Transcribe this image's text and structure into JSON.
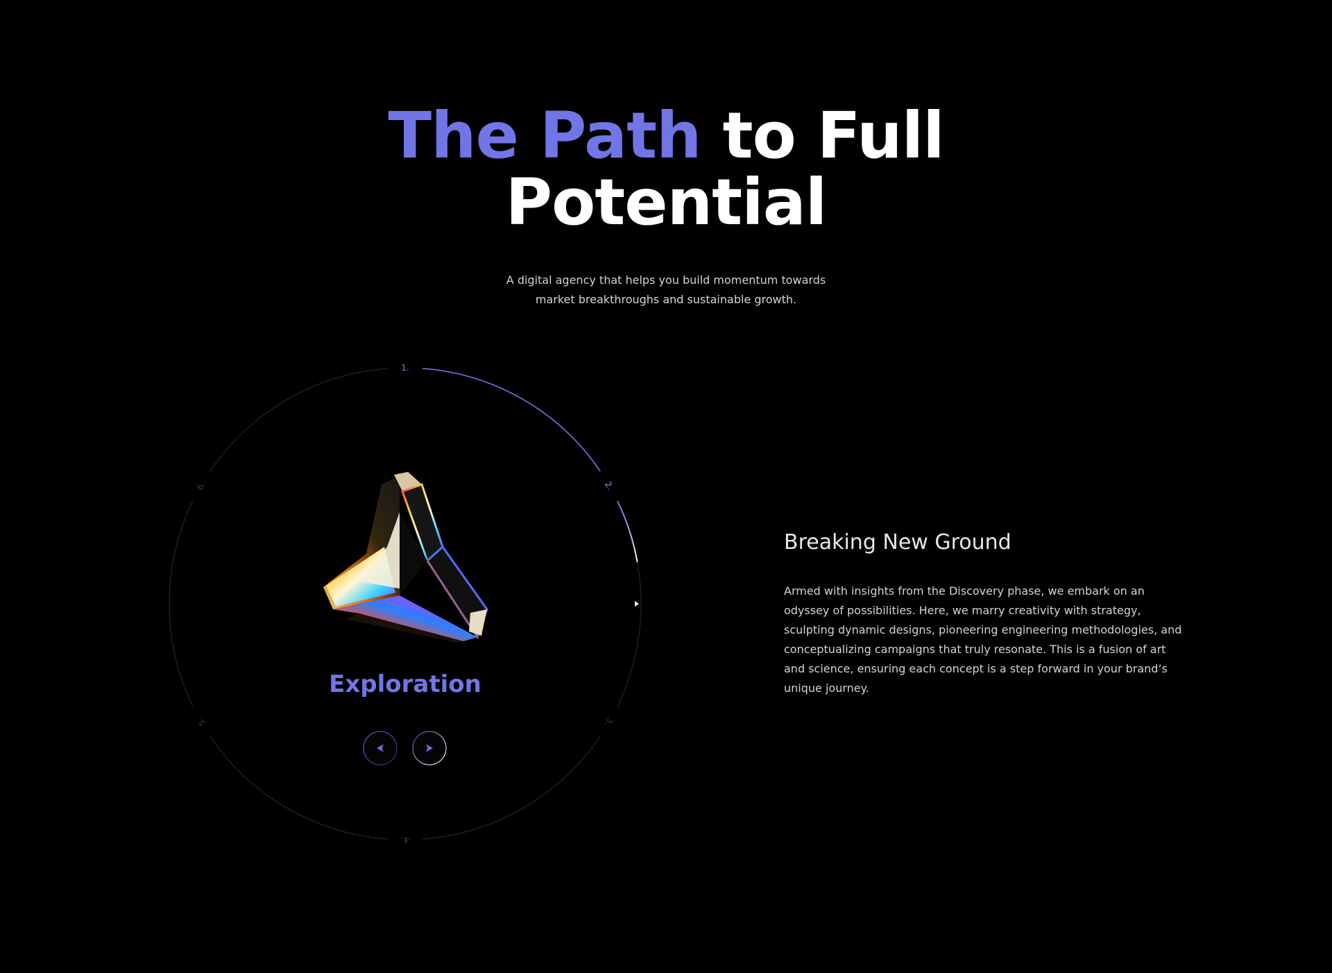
{
  "hero": {
    "title_accent": "The Path",
    "title_rest": " to Full",
    "title_line2": "Potential",
    "subtitle_line1": "A digital agency that helps you build momentum towards",
    "subtitle_line2": "market breakthroughs and sustainable growth."
  },
  "wheel": {
    "steps": [
      "1.",
      "2.",
      "3.",
      "4.",
      "5.",
      "6."
    ],
    "active_step": 2,
    "progress_fraction": 0.25,
    "current_stage": "Exploration",
    "prev_icon": "arrow-left-icon",
    "next_icon": "arrow-right-icon"
  },
  "detail": {
    "title": "Breaking New Ground",
    "body": "Armed with insights from the Discovery phase, we embark on an odyssey of possibilities. Here, we marry creativity with strategy, sculpting dynamic designs, pioneering engineering methodologies, and conceptualizing campaigns that truly resonate. This is a fusion of art and science, ensuring each concept is a step forward in your brand’s unique journey."
  },
  "colors": {
    "background": "#000000",
    "accent": "#7275e6",
    "text": "#ffffff",
    "muted_text": "#d4d4d8",
    "ring": "#2a2a2e"
  }
}
